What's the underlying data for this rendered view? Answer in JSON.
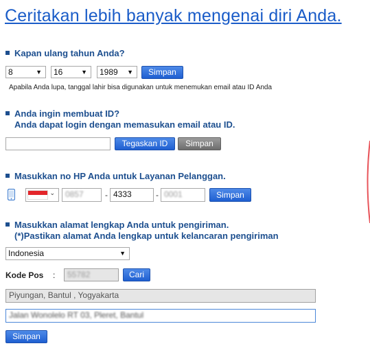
{
  "page": {
    "title": "Ceritakan lebih banyak mengenai diri Anda."
  },
  "birthday": {
    "heading": "Kapan ulang tahun Anda?",
    "month": "8",
    "day": "16",
    "year": "1989",
    "save_label": "Simpan",
    "note": "Apabila Anda lupa, tanggal lahir bisa digunakan untuk menemukan email atau ID Anda"
  },
  "create_id": {
    "heading_line1": "Anda ingin membuat ID?",
    "heading_line2": "Anda dapat login dengan memasukan email atau ID.",
    "id_value": "",
    "confirm_label": "Tegaskan ID",
    "save_label": "Simpan"
  },
  "phone": {
    "heading": "Masukkan no HP Anda untuk Layanan Pelanggan.",
    "country": "Indonesia",
    "part1": "0857",
    "part2": "4333",
    "part3": "0001",
    "separator": "-",
    "save_label": "Simpan"
  },
  "address": {
    "heading_line1": "Masukkan alamat lengkap Anda untuk pengiriman.",
    "heading_line2": "(*)Pastikan alamat Anda lengkap untuk kelancaran pengiriman",
    "country": "Indonesia",
    "postcode_label": "Kode Pos",
    "postcode_colon": ":",
    "postcode_value": "55782",
    "search_label": "Cari",
    "region": "Piyungan, Bantul , Yogyakarta",
    "detail": "Jalan Wonolelo RT 03, Pleret, Bantul",
    "save_label": "Simpan"
  },
  "colors": {
    "title": "#1a5cc8",
    "heading": "#1d4f8f",
    "button_blue": "#1f5fd1",
    "button_gray": "#6d6d6d"
  }
}
